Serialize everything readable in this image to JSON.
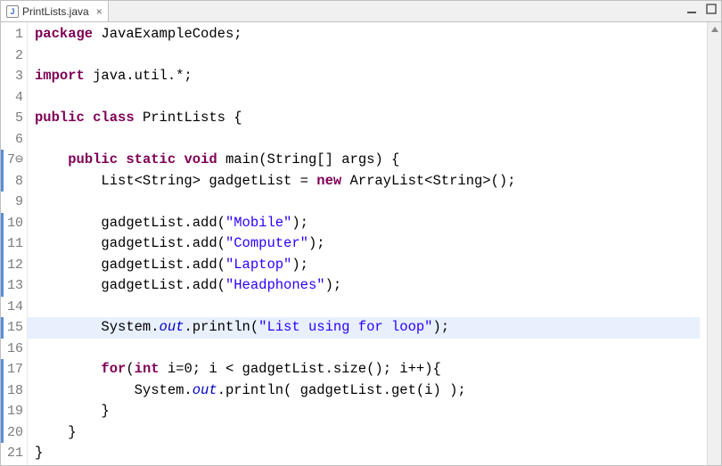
{
  "tab": {
    "icon_letter": "J",
    "filename": "PrintLists.java",
    "close_glyph": "×"
  },
  "gutter": {
    "line_count": 21,
    "marked_lines": [
      7,
      8,
      10,
      11,
      12,
      13,
      15,
      17,
      18,
      19,
      20
    ],
    "method_line": 7
  },
  "highlight_line": 15,
  "code": {
    "l1": [
      {
        "c": "kw",
        "t": "package"
      },
      {
        "c": "txt",
        "t": " JavaExampleCodes;"
      }
    ],
    "l2": [
      {
        "c": "txt",
        "t": ""
      }
    ],
    "l3": [
      {
        "c": "kw",
        "t": "import"
      },
      {
        "c": "txt",
        "t": " java.util.*;"
      }
    ],
    "l4": [
      {
        "c": "txt",
        "t": ""
      }
    ],
    "l5": [
      {
        "c": "kw",
        "t": "public"
      },
      {
        "c": "txt",
        "t": " "
      },
      {
        "c": "kw",
        "t": "class"
      },
      {
        "c": "txt",
        "t": " PrintLists {"
      }
    ],
    "l6": [
      {
        "c": "txt",
        "t": ""
      }
    ],
    "l7": [
      {
        "c": "txt",
        "t": "    "
      },
      {
        "c": "kw",
        "t": "public"
      },
      {
        "c": "txt",
        "t": " "
      },
      {
        "c": "kw",
        "t": "static"
      },
      {
        "c": "txt",
        "t": " "
      },
      {
        "c": "kw",
        "t": "void"
      },
      {
        "c": "txt",
        "t": " main(String[] args) {"
      }
    ],
    "l8": [
      {
        "c": "txt",
        "t": "        List<String> gadgetList = "
      },
      {
        "c": "kw",
        "t": "new"
      },
      {
        "c": "txt",
        "t": " ArrayList<String>();"
      }
    ],
    "l9": [
      {
        "c": "txt",
        "t": ""
      }
    ],
    "l10": [
      {
        "c": "txt",
        "t": "        gadgetList.add("
      },
      {
        "c": "str",
        "t": "\"Mobile\""
      },
      {
        "c": "txt",
        "t": ");"
      }
    ],
    "l11": [
      {
        "c": "txt",
        "t": "        gadgetList.add("
      },
      {
        "c": "str",
        "t": "\"Computer\""
      },
      {
        "c": "txt",
        "t": ");"
      }
    ],
    "l12": [
      {
        "c": "txt",
        "t": "        gadgetList.add("
      },
      {
        "c": "str",
        "t": "\"Laptop\""
      },
      {
        "c": "txt",
        "t": ");"
      }
    ],
    "l13": [
      {
        "c": "txt",
        "t": "        gadgetList.add("
      },
      {
        "c": "str",
        "t": "\"Headphones\""
      },
      {
        "c": "txt",
        "t": ");"
      }
    ],
    "l14": [
      {
        "c": "txt",
        "t": ""
      }
    ],
    "l15": [
      {
        "c": "txt",
        "t": "        System."
      },
      {
        "c": "fld",
        "t": "out"
      },
      {
        "c": "txt",
        "t": ".println("
      },
      {
        "c": "str",
        "t": "\"List using for loop\""
      },
      {
        "c": "txt",
        "t": ");"
      }
    ],
    "l16": [
      {
        "c": "txt",
        "t": ""
      }
    ],
    "l17": [
      {
        "c": "txt",
        "t": "        "
      },
      {
        "c": "kw",
        "t": "for"
      },
      {
        "c": "txt",
        "t": "("
      },
      {
        "c": "kw",
        "t": "int"
      },
      {
        "c": "txt",
        "t": " i=0; i < gadgetList.size(); i++){"
      }
    ],
    "l18": [
      {
        "c": "txt",
        "t": "            System."
      },
      {
        "c": "fld",
        "t": "out"
      },
      {
        "c": "txt",
        "t": ".println( gadgetList.get(i) );"
      }
    ],
    "l19": [
      {
        "c": "txt",
        "t": "        }"
      }
    ],
    "l20": [
      {
        "c": "txt",
        "t": "    }"
      }
    ],
    "l21": [
      {
        "c": "txt",
        "t": "}"
      }
    ]
  }
}
